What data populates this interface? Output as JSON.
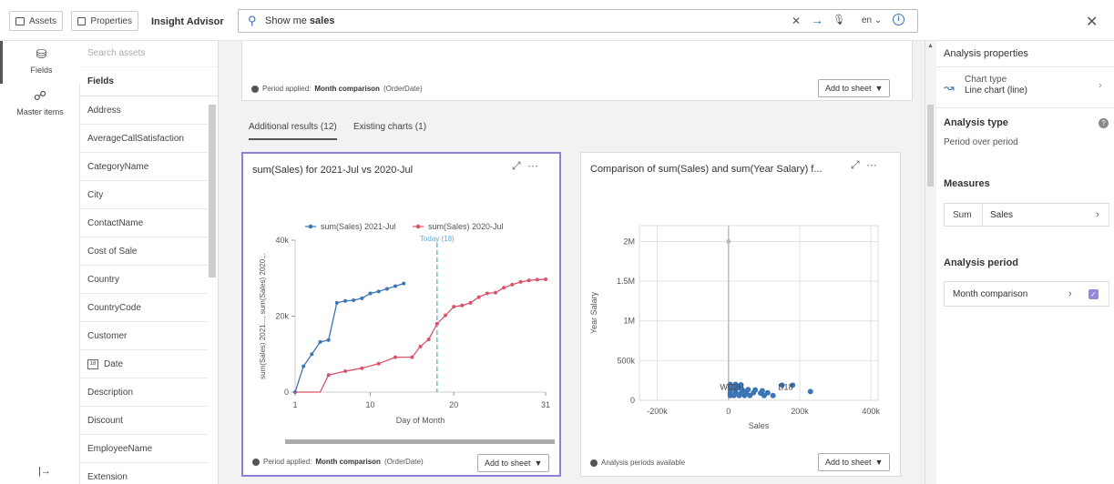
{
  "topbar": {
    "assets_label": "Assets",
    "properties_label": "Properties",
    "title": "Insight Advisor",
    "search_prefix": "Show me ",
    "search_bold": "sales",
    "lang": "en ⌄"
  },
  "leftnav": {
    "fields_label": "Fields",
    "master_label": "Master items"
  },
  "fieldlist": {
    "search_placeholder": "Search assets",
    "header": "Fields",
    "items": [
      "Address",
      "AverageCallSatisfaction",
      "CategoryName",
      "City",
      "ContactName",
      "Cost of Sale",
      "Country",
      "CountryCode",
      "Customer",
      "Date",
      "Description",
      "Discount",
      "EmployeeName",
      "Extension"
    ]
  },
  "main": {
    "top_period_label": "Period applied:",
    "top_period_value": "Month comparison",
    "top_period_suffix": "(OrderDate)",
    "add_to_sheet": "Add to sheet",
    "tabs": [
      "Additional results (12)",
      "Existing charts (1)"
    ],
    "card1": {
      "title": "sum(Sales) for 2021-Jul vs 2020-Jul",
      "footer_label": "Period applied:",
      "footer_value": "Month comparison",
      "footer_suffix": "(OrderDate)"
    },
    "card2": {
      "title": "Comparison of sum(Sales) and sum(Year Salary) f...",
      "footer": "Analysis periods available"
    }
  },
  "sidebar": {
    "title": "Analysis properties",
    "chart_type_label": "Chart type",
    "chart_type_value": "Line chart (line)",
    "analysis_type_label": "Analysis type",
    "analysis_type_value": "Period over period",
    "measures_label": "Measures",
    "measure_agg": "Sum",
    "measure_field": "Sales",
    "analysis_period_label": "Analysis period",
    "analysis_period_value": "Month comparison"
  },
  "chart_data": [
    {
      "type": "line",
      "title": "sum(Sales) for 2021-Jul vs 2020-Jul",
      "xlabel": "Day of Month",
      "ylabel": "sum(Sales) 2021..., sum(Sales) 2020...",
      "xticks": [
        "1",
        "10",
        "20",
        "31"
      ],
      "yticks": [
        "0",
        "20k",
        "40k"
      ],
      "xlim": [
        1,
        31
      ],
      "ylim": [
        0,
        40000
      ],
      "annotation": "Today (18)",
      "annotation_x": 18,
      "legend_position": "top",
      "series": [
        {
          "name": "sum(Sales) 2021-Jul",
          "color": "#3c75b5",
          "x": [
            1,
            2,
            3,
            4,
            5,
            6,
            7,
            8,
            9,
            10,
            11,
            12,
            13,
            14
          ],
          "y": [
            0,
            6800,
            10000,
            13200,
            13700,
            23500,
            24000,
            24200,
            24700,
            26000,
            26500,
            27200,
            27900,
            28600
          ]
        },
        {
          "name": "sum(Sales) 2020-Jul",
          "color": "#d9536b",
          "x": [
            1,
            3,
            4,
            5,
            7,
            9,
            11,
            13,
            15,
            16,
            17,
            18,
            19,
            20,
            21,
            22,
            23,
            24,
            25,
            26,
            27,
            28,
            29,
            30,
            31
          ],
          "y": [
            0,
            0,
            0,
            4500,
            5500,
            6300,
            7500,
            9200,
            9200,
            12000,
            13900,
            18000,
            20200,
            22500,
            22800,
            23500,
            25000,
            26000,
            26200,
            27500,
            28300,
            29000,
            29400,
            29600,
            29700
          ]
        }
      ]
    },
    {
      "type": "scatter",
      "title": "Comparison of sum(Sales) and sum(Year Salary) f...",
      "xlabel": "Sales",
      "ylabel": "Year Salary",
      "xticks": [
        "-200k",
        "0",
        "200k",
        "400k"
      ],
      "yticks": [
        "0",
        "500k",
        "1M",
        "1.5M",
        "2M"
      ],
      "xlim": [
        -250000,
        420000
      ],
      "ylim": [
        0,
        2200000
      ],
      "labels": [
        {
          "text": "WC2H",
          "x": 10000,
          "y": 100000
        },
        {
          "text": "D18",
          "x": 160000,
          "y": 100000
        }
      ],
      "color": "#3c75b5",
      "points": [
        {
          "x": 0,
          "y": 2000000
        },
        {
          "x": 5000,
          "y": 60000
        },
        {
          "x": 15000,
          "y": 60000
        },
        {
          "x": 30000,
          "y": 60000
        },
        {
          "x": 45000,
          "y": 60000
        },
        {
          "x": 60000,
          "y": 60000
        },
        {
          "x": 5000,
          "y": 90000
        },
        {
          "x": 20000,
          "y": 95000
        },
        {
          "x": 35000,
          "y": 90000
        },
        {
          "x": 50000,
          "y": 100000
        },
        {
          "x": 70000,
          "y": 95000
        },
        {
          "x": 90000,
          "y": 90000
        },
        {
          "x": 110000,
          "y": 95000
        },
        {
          "x": 5000,
          "y": 125000
        },
        {
          "x": 20000,
          "y": 130000
        },
        {
          "x": 40000,
          "y": 125000
        },
        {
          "x": 55000,
          "y": 135000
        },
        {
          "x": 75000,
          "y": 130000
        },
        {
          "x": 95000,
          "y": 120000
        },
        {
          "x": 5000,
          "y": 160000
        },
        {
          "x": 15000,
          "y": 165000
        },
        {
          "x": 30000,
          "y": 160000
        },
        {
          "x": 5000,
          "y": 200000
        },
        {
          "x": 20000,
          "y": 200000
        },
        {
          "x": 35000,
          "y": 195000
        },
        {
          "x": 100000,
          "y": 60000
        },
        {
          "x": 125000,
          "y": 60000
        },
        {
          "x": 150000,
          "y": 190000
        },
        {
          "x": 180000,
          "y": 190000
        },
        {
          "x": 230000,
          "y": 110000
        }
      ]
    }
  ]
}
